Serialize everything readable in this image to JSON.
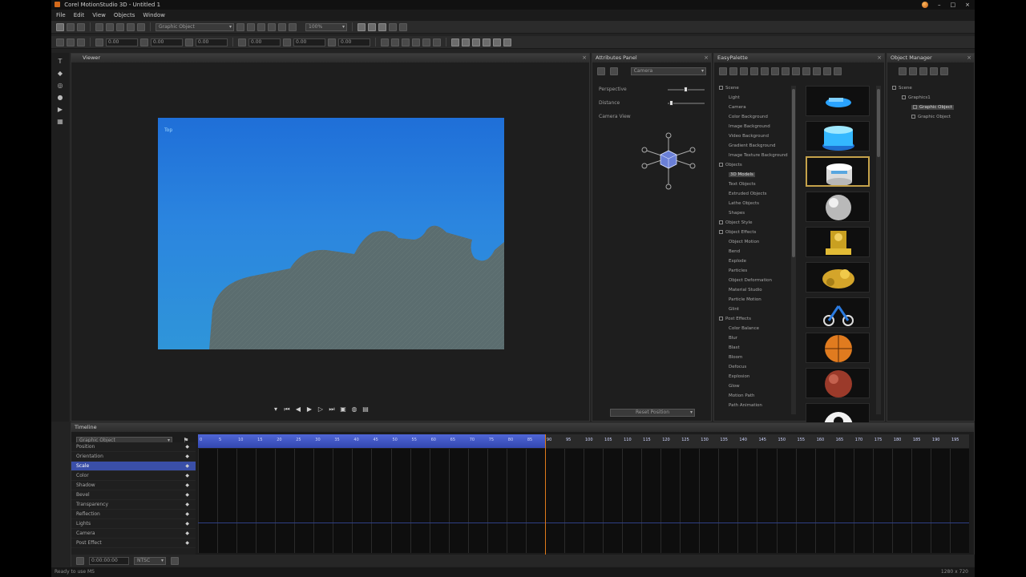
{
  "window": {
    "title": "Corel MotionStudio 3D - Untitled 1",
    "buttons": [
      "–",
      "□",
      "×"
    ]
  },
  "menu": [
    "File",
    "Edit",
    "View",
    "Objects",
    "Window"
  ],
  "toolbar1": {
    "object_combo": "Graphic Object",
    "zoom_combo": "100%"
  },
  "toolbar2": {
    "fields": [
      "0.00",
      "0.00",
      "0.00",
      "0.00",
      "0.00",
      "0.00"
    ]
  },
  "viewport": {
    "title": "Viewer",
    "corner_label": "Top"
  },
  "attributes": {
    "title": "Attributes Panel",
    "combo": "Camera",
    "rows": [
      "Perspective",
      "Distance",
      "Camera View"
    ],
    "footer_button": "Reset Position"
  },
  "easypalette": {
    "title": "EasyPalette",
    "tree": [
      {
        "label": "Scene",
        "level": 0
      },
      {
        "label": "Light",
        "level": 1
      },
      {
        "label": "Camera",
        "level": 1
      },
      {
        "label": "Color Background",
        "level": 1
      },
      {
        "label": "Image Background",
        "level": 1
      },
      {
        "label": "Video Background",
        "level": 1
      },
      {
        "label": "Gradient Background",
        "level": 1
      },
      {
        "label": "Image Texture Background",
        "level": 1
      },
      {
        "label": "Objects",
        "level": 0
      },
      {
        "label": "3D Models",
        "level": 1,
        "selected": true
      },
      {
        "label": "Text Objects",
        "level": 1
      },
      {
        "label": "Extruded Objects",
        "level": 1
      },
      {
        "label": "Lathe Objects",
        "level": 1
      },
      {
        "label": "Shapes",
        "level": 1
      },
      {
        "label": "Object Style",
        "level": 0
      },
      {
        "label": "Object Effects",
        "level": 0
      },
      {
        "label": "Object Motion",
        "level": 1
      },
      {
        "label": "Bend",
        "level": 1
      },
      {
        "label": "Explode",
        "level": 1
      },
      {
        "label": "Particles",
        "level": 1
      },
      {
        "label": "Object Deformation",
        "level": 1
      },
      {
        "label": "Material Studio",
        "level": 1
      },
      {
        "label": "Particle Motion",
        "level": 1
      },
      {
        "label": "Glint",
        "level": 1
      },
      {
        "label": "Post Effects",
        "level": 0
      },
      {
        "label": "Color Balance",
        "level": 1
      },
      {
        "label": "Blur",
        "level": 1
      },
      {
        "label": "Blast",
        "level": 1
      },
      {
        "label": "Bloom",
        "level": 1
      },
      {
        "label": "Defocus",
        "level": 1
      },
      {
        "label": "Explosion",
        "level": 1
      },
      {
        "label": "Glow",
        "level": 1
      },
      {
        "label": "Motion Path",
        "level": 1
      },
      {
        "label": "Path Animation",
        "level": 1
      }
    ],
    "thumbnails": [
      "blue-ship",
      "blue-cake",
      "white-cake",
      "silver-sphere",
      "golden-statue",
      "golden-dragon",
      "tricycle",
      "basketball",
      "red-ball",
      "eyeball"
    ]
  },
  "object_manager": {
    "title": "Object Manager",
    "tree": [
      {
        "label": "Scene",
        "level": 0
      },
      {
        "label": "Graphics1",
        "level": 1
      },
      {
        "label": "Graphic Object",
        "level": 2,
        "selected": true
      },
      {
        "label": "Graphic Object",
        "level": 2
      }
    ]
  },
  "timeline": {
    "title": "Timeline",
    "combo": "Graphic Object",
    "tracks": [
      "Position",
      "Orientation",
      "Scale",
      "Color",
      "Shadow",
      "Bevel",
      "Transparency",
      "Reflection",
      "Lights",
      "Camera",
      "Post Effect"
    ],
    "selected_track": "Scale",
    "ruler_start": 0,
    "ruler_step": 5,
    "ruler_count": 40,
    "selection_frames": 90,
    "bottom_field": "0:00:00:00",
    "bottom_combo": "NTSC"
  },
  "status": {
    "left": "Ready to use MS",
    "right": "1280 x 720"
  },
  "colors": {
    "viewport_sky_top": "#1f6fd8",
    "viewport_sky_bottom": "#2f95d9",
    "landscape": "#5b6d6f",
    "selection_blue": "#3f56c2",
    "playhead": "#e07a1a",
    "thumb_highlight": "#c5a24a"
  }
}
